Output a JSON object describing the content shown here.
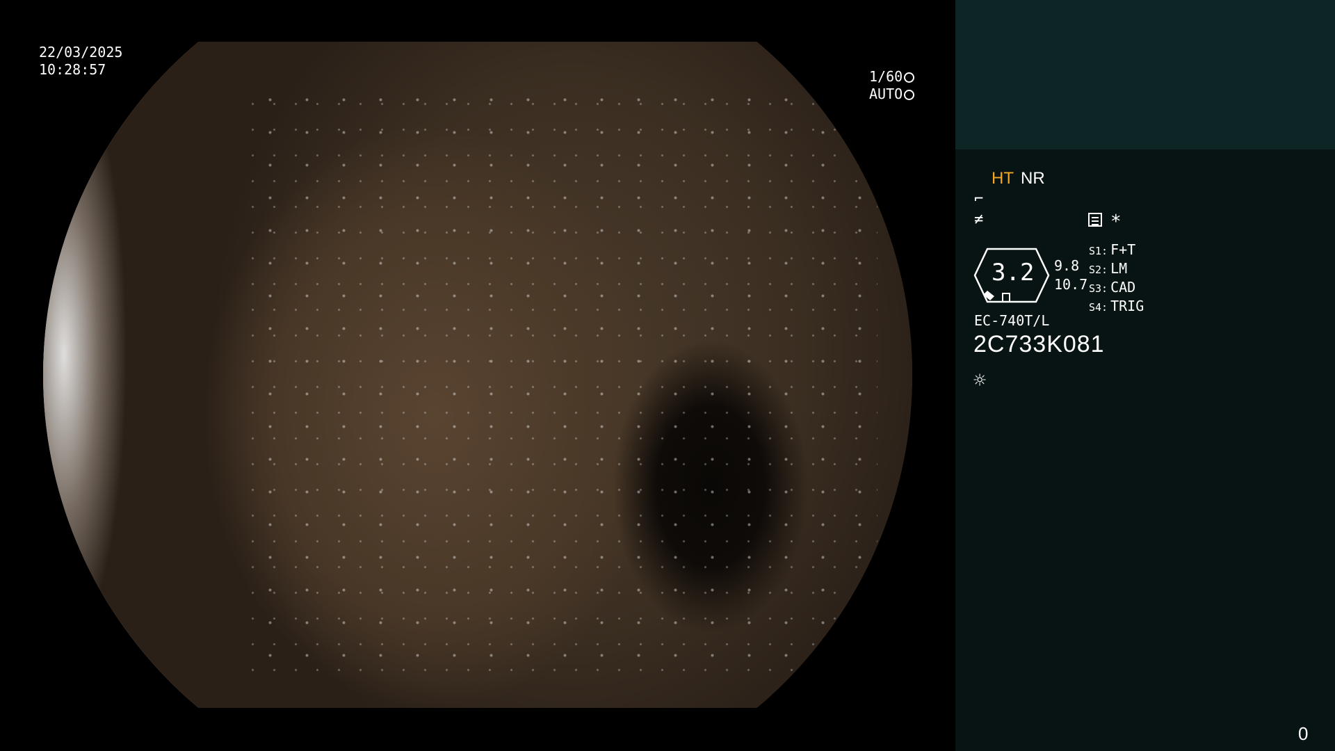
{
  "overlay": {
    "date": "22/03/2025",
    "time": "10:28:57",
    "shutter": "1/60",
    "exposure_mode": "AUTO"
  },
  "panel": {
    "ht": "HT",
    "nr": "NR",
    "gauge_value": "3.2",
    "value_a": "9.8",
    "value_b": "10.7",
    "switches": [
      {
        "key": "S1:",
        "value": "F+T"
      },
      {
        "key": "S2:",
        "value": "LM"
      },
      {
        "key": "S3:",
        "value": "CAD"
      },
      {
        "key": "S4:",
        "value": "TRIG"
      }
    ],
    "model": "EC-740T/L",
    "serial": "2C733K081",
    "counter": "0"
  },
  "colors": {
    "ht_highlight": "#f5a623",
    "panel_top": "#0e2526",
    "panel_bottom": "#071413"
  },
  "icons": [
    "shutter-icon",
    "auto-exposure-icon",
    "enhance-icon",
    "frequency-icon",
    "menu-icon",
    "star-icon",
    "light-icon"
  ]
}
